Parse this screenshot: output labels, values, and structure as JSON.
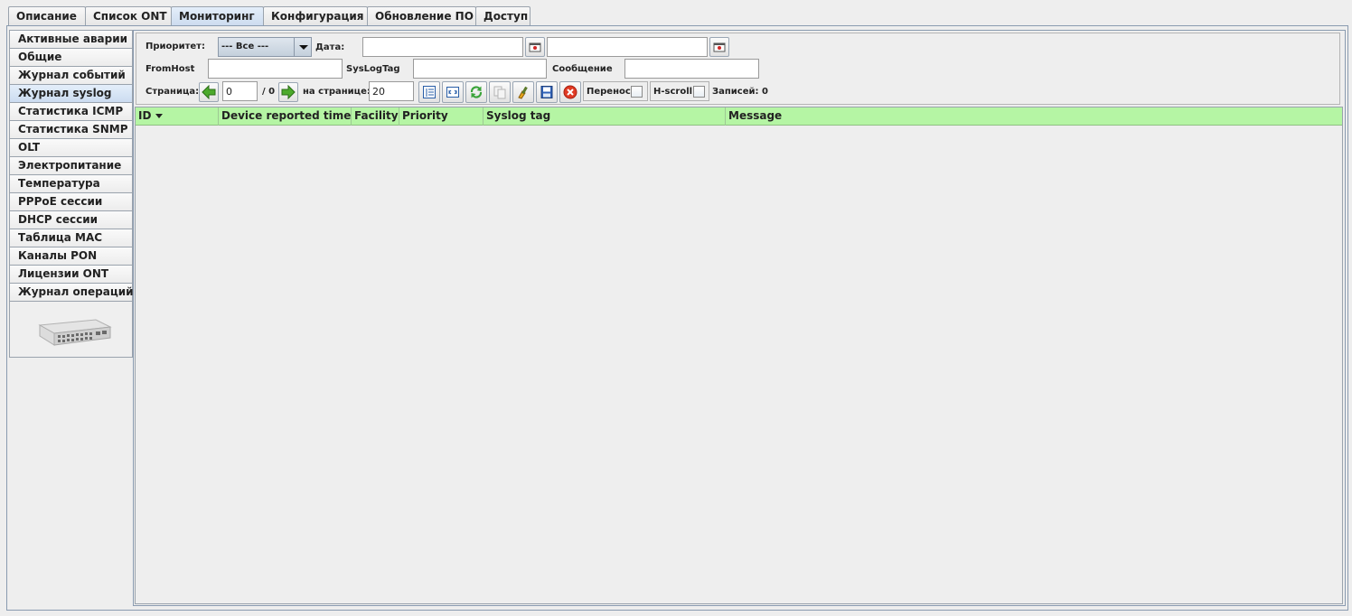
{
  "top_tabs": [
    "Описание",
    "Список ONT",
    "Мониторинг",
    "Конфигурация",
    "Обновление ПО",
    "Доступ"
  ],
  "active_top_tab": "Мониторинг",
  "side_tabs": [
    "Активные аварии",
    "Общие",
    "Журнал событий",
    "Журнал syslog",
    "Статистика ICMP",
    "Статистика SNMP",
    "OLT",
    "Электропитание",
    "Температура",
    "PPPoE сессии",
    "DHCP сессии",
    "Таблица MAC",
    "Каналы PON",
    "Лицензии ONT",
    "Журнал операций"
  ],
  "active_side_tab": "Журнал syslog",
  "filters": {
    "priority_label": "Приоритет:",
    "priority_value": "--- Все ---",
    "date_label": "Дата:",
    "date_from": "",
    "date_to": "",
    "fromhost_label": "FromHost",
    "fromhost_value": "",
    "syslogtag_label": "SysLogTag",
    "syslogtag_value": "",
    "message_label": "Сообщение",
    "message_value": ""
  },
  "pager": {
    "page_label": "Страница:",
    "page_value": "0",
    "page_total": "/ 0",
    "per_page_label": "на странице:",
    "per_page_value": "20",
    "wrap_label": "Перенос",
    "hscroll_label": "H-scroll",
    "records_label": "Записей: 0"
  },
  "icons": {
    "prev": "arrow-left-icon",
    "next": "arrow-right-icon",
    "calendar": "calendar-icon",
    "columns": "column-list-icon",
    "fit": "fit-width-icon",
    "refresh": "refresh-icon",
    "copy": "copy-icon",
    "clear_filter": "clear-filter-icon",
    "save": "save-icon",
    "close": "close-icon"
  },
  "table": {
    "columns": [
      "ID",
      "Device reported time",
      "Facility",
      "Priority",
      "Syslog tag",
      "Message"
    ],
    "sorted_column": "ID",
    "rows": []
  },
  "colors": {
    "header_green": "#b5f5a4",
    "active_tab_blue": "#cbdcf0"
  }
}
